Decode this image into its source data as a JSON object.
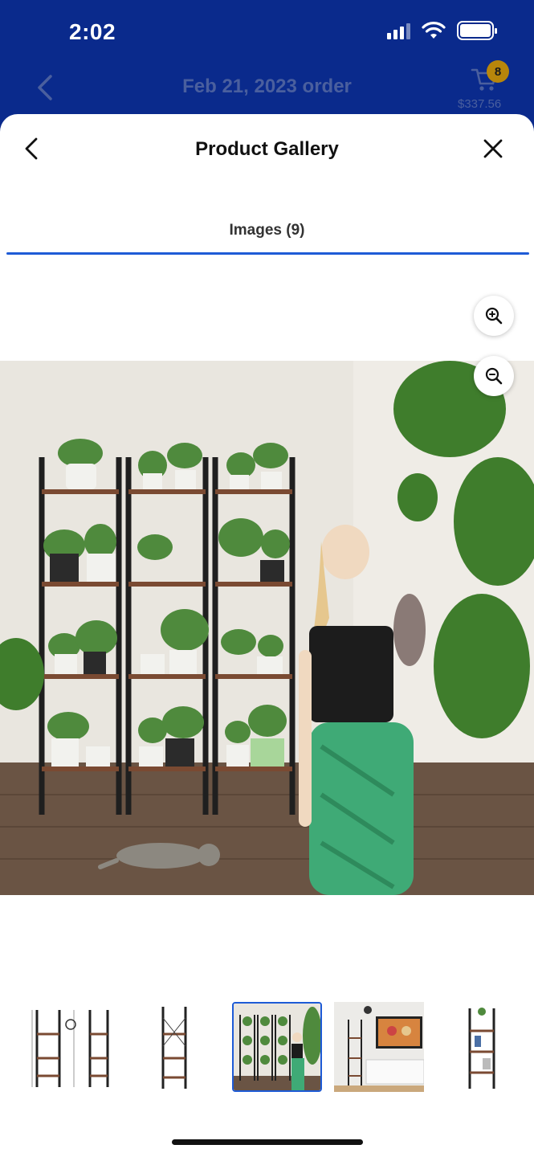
{
  "status_bar": {
    "time": "2:02"
  },
  "app_header": {
    "title": "Feb 21, 2023 order",
    "cart_count": "8",
    "cart_total": "$337.56"
  },
  "gallery": {
    "title": "Product Gallery",
    "tab_label": "Images (9)",
    "selected_index": 2
  },
  "icons": {
    "back": "chevron-left-icon",
    "close": "close-icon",
    "cart": "cart-icon",
    "zoom_in": "zoom-in-icon",
    "zoom_out": "zoom-out-icon"
  },
  "colors": {
    "header_bg": "#0a2a8c",
    "accent": "#1e5bd6",
    "badge": "#b8860b"
  }
}
